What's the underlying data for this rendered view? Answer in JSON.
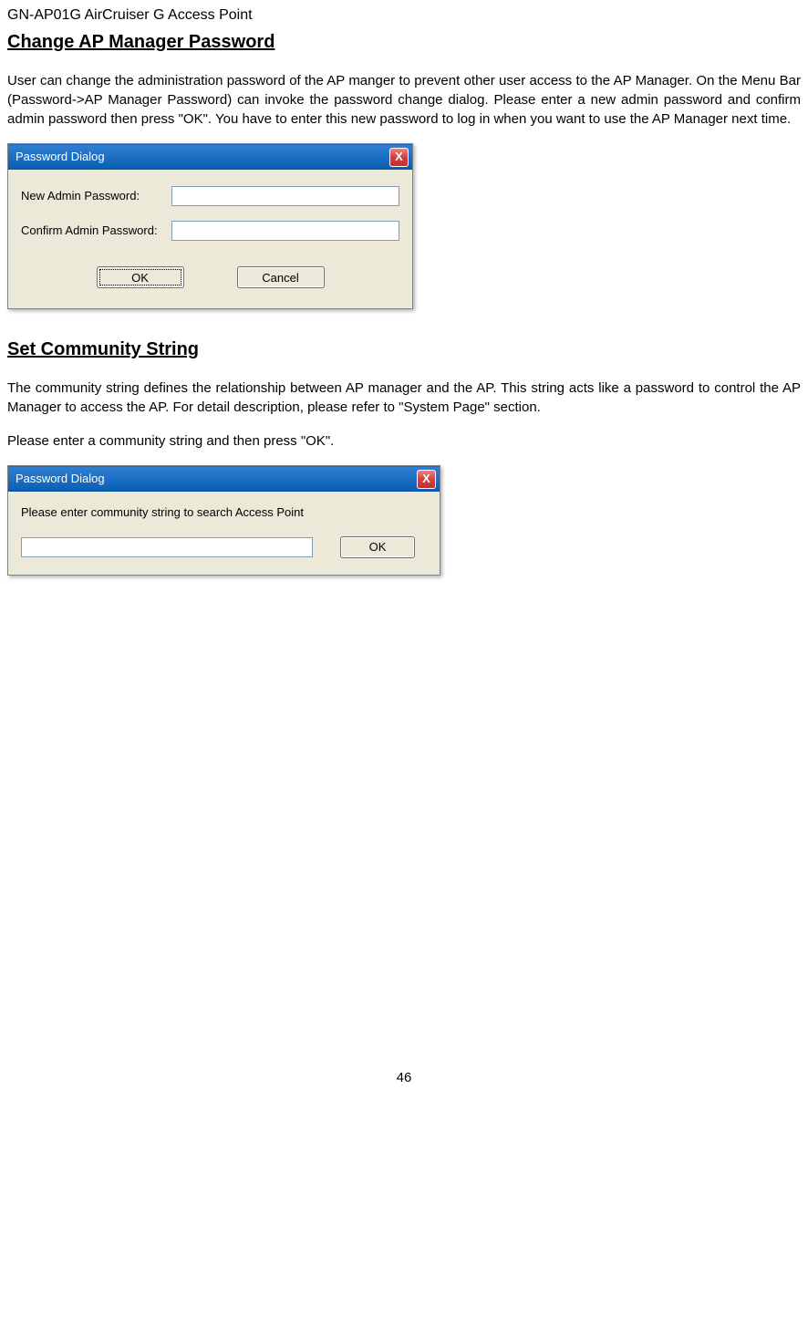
{
  "header": "GN-AP01G AirCruiser G Access Point",
  "section1": {
    "heading": "Change AP Manager Password",
    "paragraph": "User can change the administration password of the AP manger to prevent other user access to the AP Manager. On the Menu Bar (Password->AP Manager Password) can invoke the password change dialog. Please enter a new admin password and confirm admin password then press \"OK\". You have to enter this new password to log in when you want to use the AP Manager next time."
  },
  "dialog1": {
    "title": "Password Dialog",
    "close": "X",
    "new_label": "New Admin Password:",
    "confirm_label": "Confirm Admin Password:",
    "new_value": "",
    "confirm_value": "",
    "ok": "OK",
    "cancel": "Cancel"
  },
  "section2": {
    "heading": "Set Community String",
    "paragraph1": "The community string defines the relationship between AP manager and the AP. This string acts like a password to control the AP Manager to access the AP.  For detail description, please refer to \"System Page\" section.",
    "paragraph2": "Please enter a community string and then press \"OK\"."
  },
  "dialog2": {
    "title": "Password Dialog",
    "close": "X",
    "label": "Please enter community string to search Access Point",
    "value": "",
    "ok": "OK"
  },
  "page_number": "46"
}
